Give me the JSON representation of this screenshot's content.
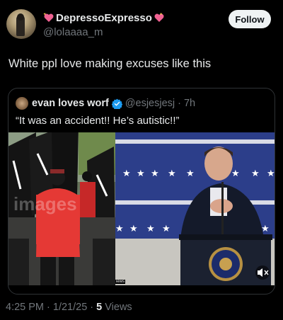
{
  "author": {
    "display_name": "DepressoExpresso",
    "handle": "@lolaaaa_m",
    "follow_label": "Follow"
  },
  "tweet": {
    "text": "White ppl love making excuses like this",
    "timestamp": "4:25 PM · 1/21/25 · ",
    "views_count": "5",
    "views_label": " Views"
  },
  "quoted_tweet": {
    "display_name": "evan loves worf",
    "handle": "@esjesjesj",
    "time": "7h",
    "text": "“It was an accident!! He’s autistic!!”",
    "left_image_watermark": "images",
    "left_image_caption": "iews"
  },
  "colors": {
    "background": "#000000",
    "text_primary": "#e7e9ea",
    "text_secondary": "#71767b",
    "verified_blue": "#1d9bf0",
    "heart_pink": "#f06292",
    "follow_bg": "#eff3f4"
  },
  "icons": [
    "sparkling-heart-icon",
    "verified-badge-icon",
    "mute-icon"
  ]
}
